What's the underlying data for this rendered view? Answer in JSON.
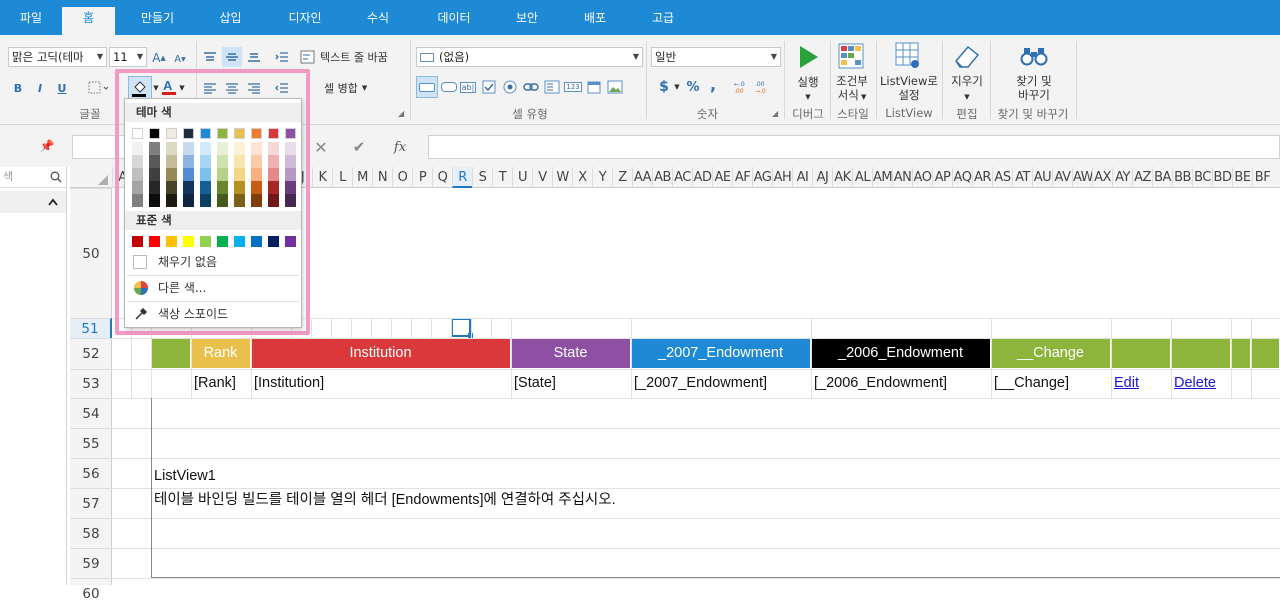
{
  "tabs": [
    "파일",
    "홈",
    "만들기",
    "삽입",
    "디자인",
    "수식",
    "데이터",
    "보안",
    "배포",
    "고급"
  ],
  "font": {
    "name": "맑은 고딕(테마",
    "size": "11",
    "bold": "B",
    "italic": "I",
    "underline": "U",
    "group_label": "글꼴"
  },
  "alignment": {
    "wrap_text": "텍스트 줄 바꿈",
    "merge": "셀 병합",
    "group_label": "맞춤"
  },
  "cell_type": {
    "style_value": "(없음)",
    "group_label": "셀 유형"
  },
  "number": {
    "format_value": "일반",
    "currency": "$",
    "percent": "%",
    "comma": ",",
    "group_label": "숫자"
  },
  "debug": {
    "run_line1": "실행",
    "group_label": "디버그"
  },
  "style": {
    "cond_line1": "조건부",
    "cond_line2": "서식",
    "group_label": "스타일"
  },
  "listview": {
    "line1": "ListView로",
    "line2": "설정",
    "group_label": "ListView"
  },
  "edit": {
    "clear": "지우기",
    "group_label": "편집"
  },
  "find": {
    "line1": "찾기 및",
    "line2": "바꾸기",
    "group_label": "찾기 및 바꾸기"
  },
  "formula_bar": {
    "fx": "fx"
  },
  "left_pane": {
    "search_placeholder": "색"
  },
  "columns": [
    "A",
    "B",
    "C",
    "D",
    "E",
    "F",
    "G",
    "H",
    "I",
    "J",
    "K",
    "L",
    "M",
    "N",
    "O",
    "P",
    "Q",
    "R",
    "S",
    "T",
    "U",
    "V",
    "W",
    "X",
    "Y",
    "Z",
    "AA",
    "AB",
    "AC",
    "AD",
    "AE",
    "AF",
    "AG",
    "AH",
    "AI",
    "AJ",
    "AK",
    "AL",
    "AM",
    "AN",
    "AO",
    "AP",
    "AQ",
    "AR",
    "AS",
    "AT",
    "AU",
    "AV",
    "AW",
    "AX",
    "AY",
    "AZ",
    "BA",
    "BB",
    "BC",
    "BD",
    "BE",
    "BF"
  ],
  "rows": [
    "50",
    "51",
    "52",
    "53",
    "54",
    "55",
    "56",
    "57",
    "58",
    "59",
    "60"
  ],
  "table": {
    "headers": [
      "Rank",
      "Institution",
      "State",
      "_2007_Endowment",
      "_2006_Endowment",
      "__Change"
    ],
    "placeholders": [
      "[Rank]",
      "[Institution]",
      "[State]",
      "[_2007_Endowment]",
      "[_2006_Endowment]",
      "[__Change]"
    ],
    "edit": "Edit",
    "delete": "Delete",
    "header_colors": [
      "#8db53c",
      "#e9c04c",
      "#d9393a",
      "#8e50a3",
      "#1e89d4",
      "#000000",
      "#8db53c"
    ]
  },
  "note": {
    "title": "ListView1",
    "text": "테이블 바인딩 빌드를 테이블 열의 헤더 [Endowments]에 연결하여 주십시오."
  },
  "color_picker": {
    "theme_label": "테마 색",
    "standard_label": "표준 색",
    "no_fill": "채우기 없음",
    "more_colors": "다른 색...",
    "eyedropper": "색상 스포이드",
    "theme_top": [
      "#ffffff",
      "#000000",
      "#eeece1",
      "#1f2d3d",
      "#1e89d4",
      "#8db53c",
      "#e9c04c",
      "#ef7d31",
      "#d9393a",
      "#8e50a3"
    ],
    "theme_shades": [
      [
        "#f2f2f2",
        "#7f7f7f",
        "#ddd9c3",
        "#c6d9f0",
        "#d3eafa",
        "#e6f0d6",
        "#fbf1d6",
        "#fde4d4",
        "#f6d7d8",
        "#e7dcec"
      ],
      [
        "#d8d8d8",
        "#595959",
        "#c4bd97",
        "#8db3e2",
        "#a6d5f5",
        "#cee1ae",
        "#f7e4ae",
        "#fbcaa9",
        "#eeb0b0",
        "#cfbad9"
      ],
      [
        "#bfbfbf",
        "#3f3f3f",
        "#938953",
        "#548dd4",
        "#7ac0ef",
        "#b5d287",
        "#f2d686",
        "#f9b07e",
        "#e58889",
        "#b797c6"
      ],
      [
        "#a5a5a5",
        "#262626",
        "#494429",
        "#17365d",
        "#155f95",
        "#6a872d",
        "#b79024",
        "#c25d13",
        "#a92626",
        "#6b3c7b"
      ],
      [
        "#7f7f7f",
        "#0c0c0c",
        "#1d1b10",
        "#0f243e",
        "#0e4063",
        "#475a1e",
        "#7a6018",
        "#813e0d",
        "#711919",
        "#472852"
      ]
    ],
    "standard": [
      "#c00000",
      "#ff0000",
      "#ffc000",
      "#ffff00",
      "#92d050",
      "#00b050",
      "#00b0f0",
      "#0070c0",
      "#002060",
      "#7030a0"
    ]
  }
}
